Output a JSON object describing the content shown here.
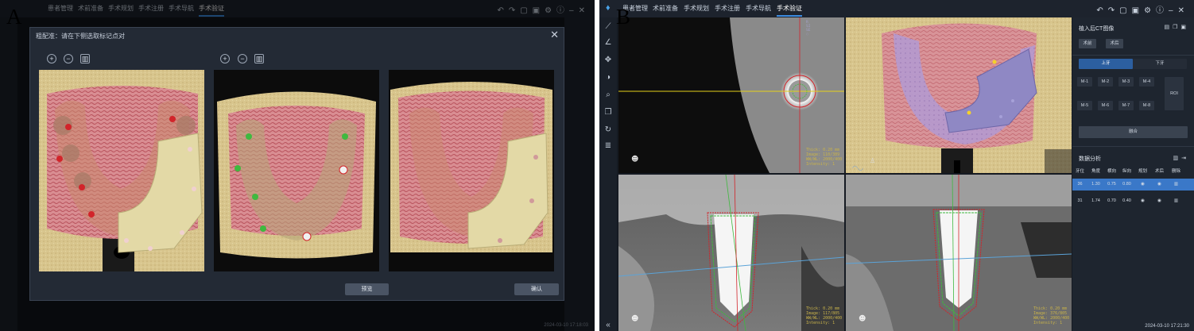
{
  "panel_a": {
    "letter": "A",
    "dialog": {
      "title": "粗配准：请在下侧选取标记点对",
      "close_glyph": "✕",
      "preview_label": "预览",
      "confirm_label": "确认"
    },
    "bg_status": "2024-03-10 17:18:03"
  },
  "panel_b": {
    "letter": "B",
    "tabs": [
      "患者管理",
      "术前准备",
      "手术规划",
      "手术注册",
      "手术导航",
      "手术验证"
    ],
    "active_tab": "手术验证",
    "right_panel": {
      "import_title": "植入后CT图像",
      "btn_preop": "术前",
      "btn_postop": "术后",
      "tab_upper": "上牙",
      "tab_lower": "下牙",
      "markers": [
        "M-1",
        "M-2",
        "M-3",
        "M-4",
        "M-5",
        "M-6",
        "M-7",
        "M-8"
      ],
      "roi": "ROI",
      "fusion": "融合",
      "analysis_title": "数据分析",
      "table_headers": [
        "牙位",
        "角度",
        "横向",
        "纵向",
        "规划",
        "术后",
        "删除"
      ],
      "rows": [
        {
          "tooth": "36",
          "angle": "1.30",
          "lateral": "0.75",
          "vertical": "0.80"
        },
        {
          "tooth": "31",
          "angle": "1.74",
          "lateral": "0.70",
          "vertical": "0.40"
        }
      ]
    },
    "timestamp": "2024-03-10 17:21:30",
    "viewport_overlays": {
      "axial": "Thick: 0.20 mm\nImage: 110/389\nWW/WL: 2000/400\nIntensity: 1",
      "sag": "Thick: 0.20 mm\nImage: 117/805\nWW/WL: 2000/400\nIntensity: 1",
      "cor": "Thick: 0.20 mm\nImage: 376/805\nWW/WL: 2000/400\nIntensity: 1"
    }
  },
  "colors": {
    "accent": "#3b8be0",
    "selected_row": "#3a78c8",
    "marker_red": "#d2242a",
    "marker_green": "#3fb93f"
  }
}
